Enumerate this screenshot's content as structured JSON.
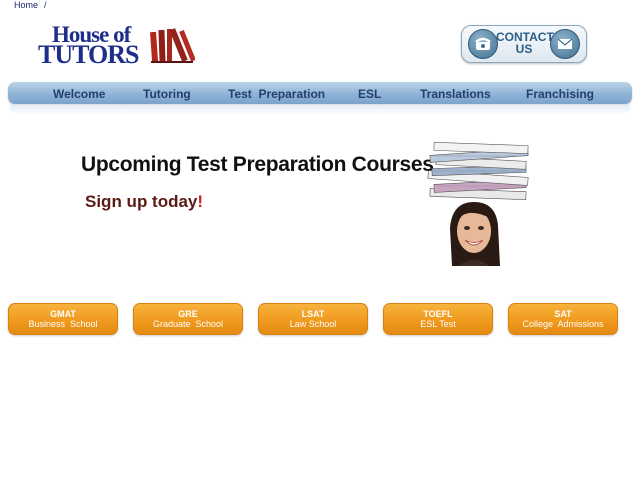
{
  "breadcrumb": {
    "home": "Home",
    "separator": "/"
  },
  "logo": {
    "line1": "House of",
    "line2": "TUTORS"
  },
  "contact": {
    "line1": "CONTACT",
    "line2": "US"
  },
  "nav": [
    {
      "label": "Welcome"
    },
    {
      "label": "Tutoring"
    },
    {
      "label": "Test  Preparation"
    },
    {
      "label": "ESL"
    },
    {
      "label": "Translations"
    },
    {
      "label": "Franchising"
    }
  ],
  "hero": {
    "title": "Upcoming Test Preparation Courses",
    "subtitle": "Sign up today",
    "exclaim": "!"
  },
  "courses": [
    {
      "code": "GMAT",
      "desc": "Business  School"
    },
    {
      "code": "GRE",
      "desc": "Graduate  School"
    },
    {
      "code": "LSAT",
      "desc": "Law School"
    },
    {
      "code": "TOEFL",
      "desc": "ESL Test"
    },
    {
      "code": "SAT",
      "desc": "College  Admissions"
    }
  ],
  "colors": {
    "brand_blue": "#1d2f8a",
    "nav_blue": "#8fb3d6",
    "button_orange": "#f09a1e",
    "books_red": "#a0281c"
  },
  "icons": {
    "contact_left": "phone-icon",
    "contact_right": "envelope-icon"
  }
}
